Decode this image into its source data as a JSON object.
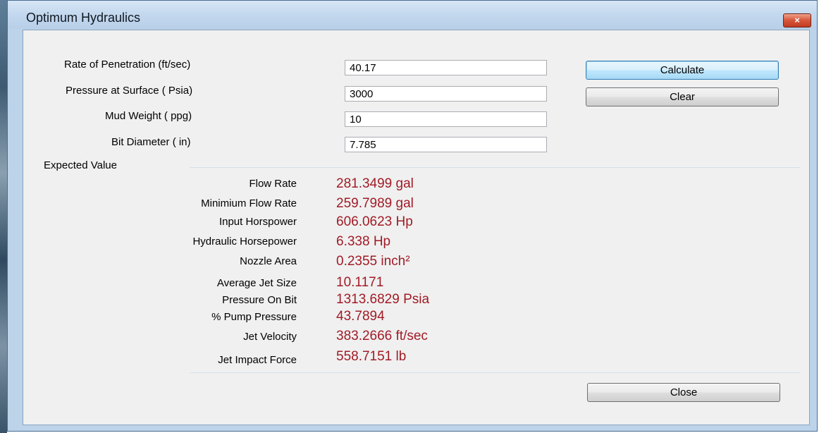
{
  "window": {
    "title": "Optimum Hydraulics",
    "close_glyph": "×"
  },
  "inputs": [
    {
      "label": "Rate of Penetration (ft/sec)",
      "value": "40.17"
    },
    {
      "label": "Pressure at Surface ( Psia)",
      "value": "3000"
    },
    {
      "label": "Mud Weight ( ppg)",
      "value": "10"
    },
    {
      "label": "Bit Diameter ( in)",
      "value": "7.785"
    }
  ],
  "buttons": {
    "calculate": "Calculate",
    "clear": "Clear",
    "close": "Close"
  },
  "results": {
    "group_label": "Expected Value",
    "rows": [
      {
        "label": "Flow Rate",
        "value": "281.3499 gal"
      },
      {
        "label": "Minimium Flow Rate",
        "value": "259.7989 gal"
      },
      {
        "label": "Input Horspower",
        "value": "606.0623 Hp"
      },
      {
        "label": "Hydraulic Horsepower",
        "value": "6.338 Hp"
      },
      {
        "label": "Nozzle Area",
        "value": "0.2355 inch²"
      },
      {
        "label": "Average Jet Size",
        "value": "10.1171"
      },
      {
        "label": "Pressure On Bit",
        "value": "1313.6829 Psia"
      },
      {
        "label": "% Pump Pressure",
        "value": "43.7894"
      },
      {
        "label": "Jet Velocity",
        "value": "383.2666 ft/sec"
      },
      {
        "label": "Jet Impact Force",
        "value": "558.7151 lb"
      }
    ]
  },
  "colors": {
    "value_text": "#a11b26",
    "window_frame": "#bcd3ea",
    "client_bg": "#f0f0f0"
  }
}
